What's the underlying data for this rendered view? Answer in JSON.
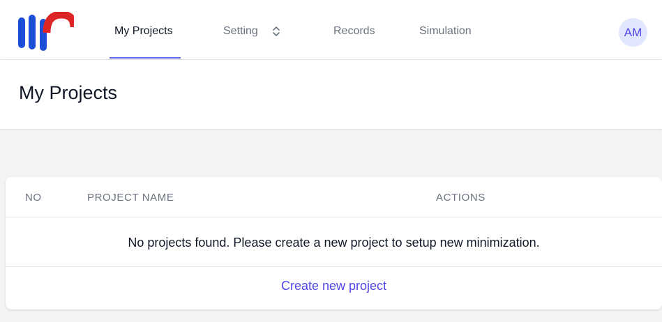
{
  "nav": {
    "items": [
      {
        "label": "My Projects"
      },
      {
        "label": "Setting"
      },
      {
        "label": "Records"
      },
      {
        "label": "Simulation"
      }
    ],
    "avatar_initials": "AM"
  },
  "header": {
    "title": "My Projects"
  },
  "table": {
    "columns": [
      "NO",
      "PROJECT NAME",
      "ACTIONS"
    ],
    "empty_message": "No projects found. Please create a new project to setup new minimization.",
    "create_label": "Create new project"
  },
  "icons": {
    "logo": "app-logo",
    "setting_toggle": "chevron-up-down-icon"
  },
  "colors": {
    "accent": "#6366f1",
    "link": "#4f46e5",
    "logo_blue": "#1d4ed8",
    "logo_red": "#dc2626",
    "avatar_bg": "#e0e7ff"
  }
}
